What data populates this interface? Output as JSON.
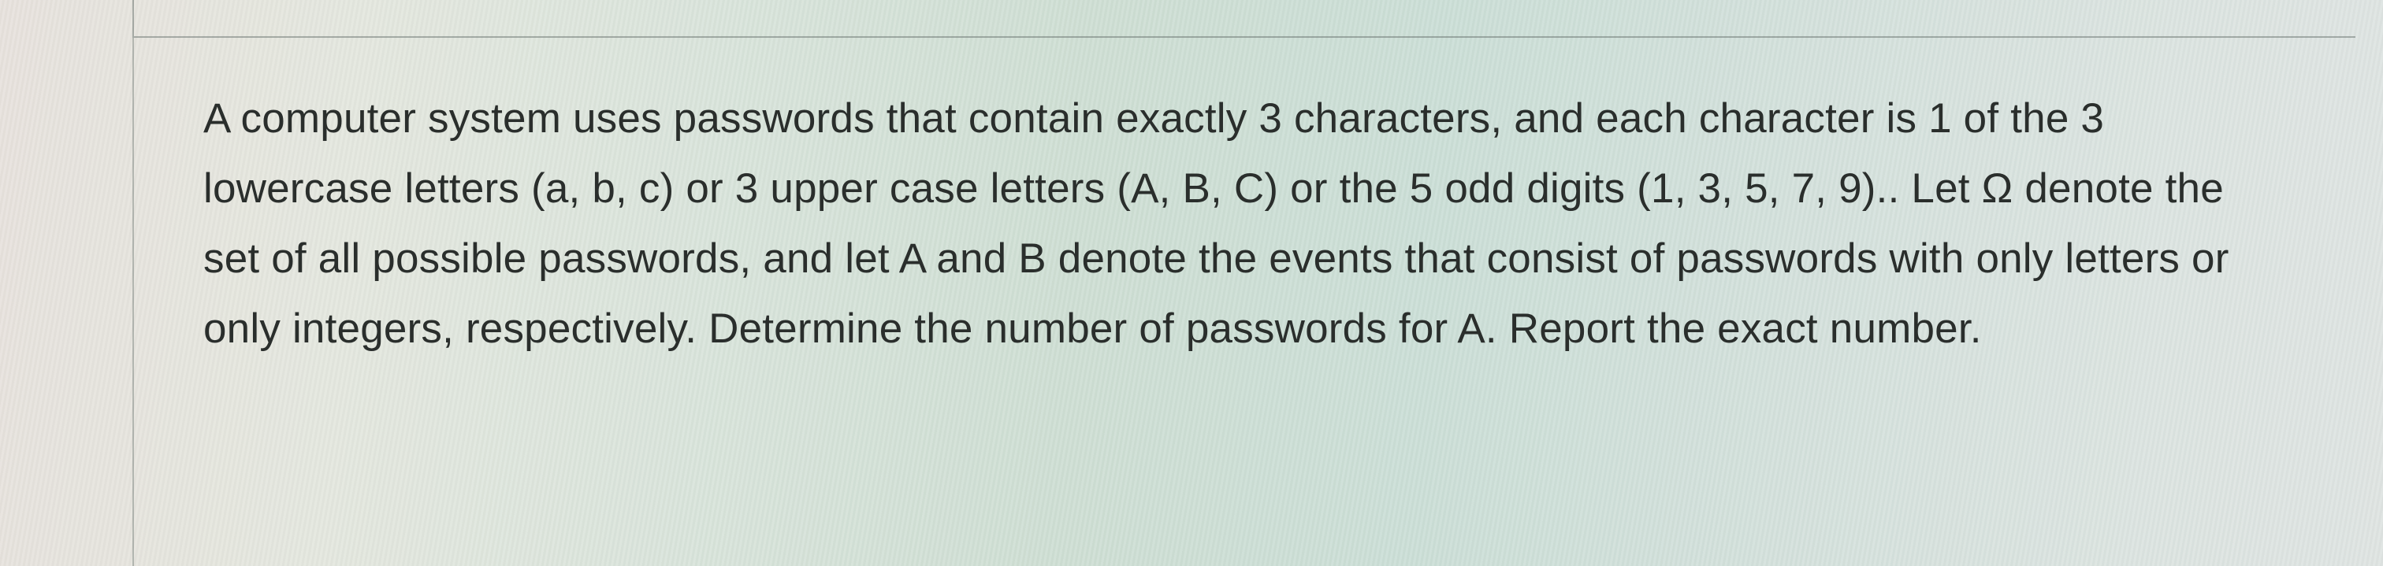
{
  "question": {
    "text": "A computer system uses passwords that contain exactly 3 characters, and each character is 1 of the 3 lowercase letters (a, b, c) or 3 upper case letters (A, B, C) or the 5 odd digits (1, 3, 5, 7, 9).. Let Ω denote the set of all possible passwords, and let A and B denote the events that consist of passwords with only letters or only integers, respectively. Determine the number of passwords for A. Report the exact number."
  }
}
